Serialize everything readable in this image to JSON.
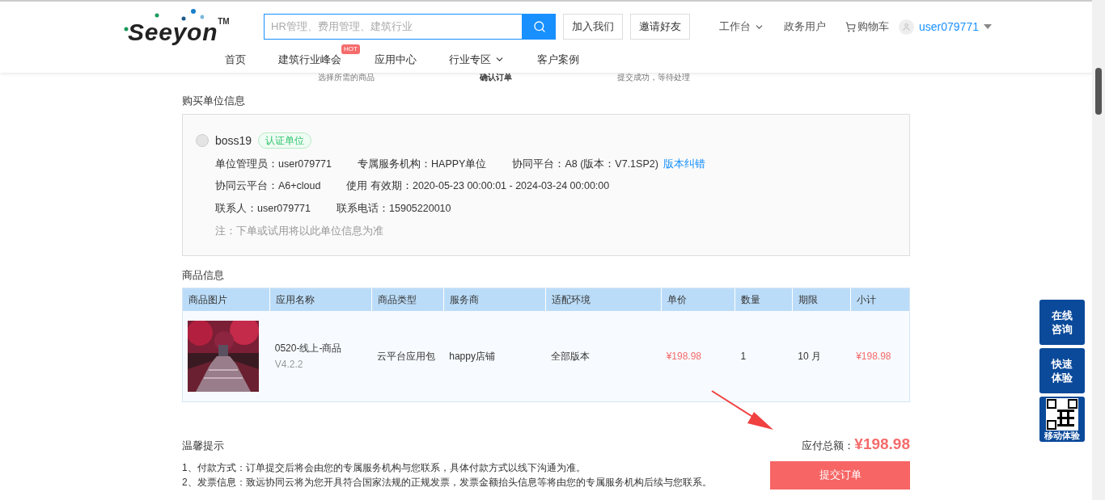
{
  "header": {
    "logo": "Seeyon",
    "trademark": "TM",
    "search": {
      "placeholder": "HR管理、费用管理、建筑行业"
    },
    "buttons": [
      "加入我们",
      "邀请好友"
    ],
    "links": [
      {
        "label": "工作台",
        "dropdown": true
      },
      {
        "label": "政务用户",
        "dropdown": false
      }
    ],
    "cart": "购物车",
    "user": "user079771",
    "nav": [
      {
        "label": "首页",
        "dropdown": false
      },
      {
        "label": "建筑行业峰会",
        "badge": "HOT",
        "dropdown": false
      },
      {
        "label": "应用中心",
        "dropdown": false
      },
      {
        "label": "行业专区",
        "dropdown": true
      },
      {
        "label": "客户案例",
        "dropdown": false
      }
    ]
  },
  "steps": [
    {
      "label": "选择所需的商品",
      "selected": false
    },
    {
      "label": "确认订单",
      "selected": true
    },
    {
      "label": "提交成功，等待处理",
      "selected": false
    }
  ],
  "buyer": {
    "heading": "购买单位信息",
    "name": "boss19",
    "tag": "认证单位",
    "rows": [
      [
        {
          "label": "单位管理员：",
          "value": "user079771"
        },
        {
          "label": "专属服务机构：",
          "value": "HAPPY单位"
        },
        {
          "label": "协同平台：",
          "value": "A8 (版本：V7.1SP2)",
          "link": "版本纠错"
        }
      ],
      [
        {
          "label": "协同云平台：",
          "value": "A6+cloud"
        },
        {
          "label": "使用 有效期：",
          "value": "2020-05-23 00:00:01 - 2024-03-24 00:00:00"
        }
      ],
      [
        {
          "label": "联系人：",
          "value": "user079771"
        },
        {
          "label": "联系电话：",
          "value": "15905220010"
        }
      ]
    ],
    "note": "注：下单或试用将以此单位信息为准"
  },
  "goods": {
    "heading": "商品信息",
    "columns": [
      "商品图片",
      "应用名称",
      "商品类型",
      "服务商",
      "适配环境",
      "单价",
      "数量",
      "期限",
      "小计"
    ],
    "rows": [
      {
        "name": "0520-线上-商品",
        "version": "V4.2.2",
        "type": "云平台应用包",
        "vendor": "happy店铺",
        "env": "全部版本",
        "price": "¥198.98",
        "qty": "1",
        "term": "10 月",
        "subtotal": "¥198.98"
      }
    ]
  },
  "tips": {
    "heading": "温馨提示",
    "lines": [
      "1、付款方式：订单提交后将会由您的专属服务机构与您联系，具体付款方式以线下沟通为准。",
      "2、发票信息：致远协同云将为您开具符合国家法规的正规发票，发票金额抬头信息等将由您的专属服务机构后续与您联系。"
    ]
  },
  "total": {
    "label": "应付总额：",
    "value": "¥198.98"
  },
  "submit": "提交订单",
  "side_buttons": [
    {
      "kind": "text",
      "label": "在线咨询"
    },
    {
      "kind": "text",
      "label": "快速体验"
    },
    {
      "kind": "qr",
      "label": "移动体验"
    }
  ]
}
